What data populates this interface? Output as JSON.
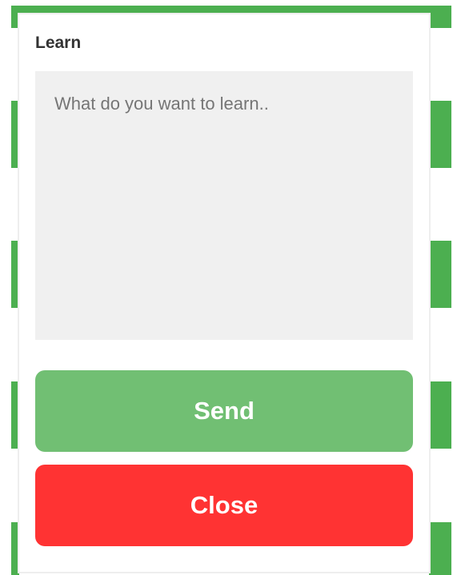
{
  "dialog": {
    "title": "Learn",
    "input": {
      "value": "",
      "placeholder": "What do you want to learn.."
    },
    "send_label": "Send",
    "close_label": "Close"
  },
  "colors": {
    "stripe_green": "#4caf50",
    "send_button": "#71bf73",
    "close_button": "#ff3333",
    "input_background": "#f0f0f0"
  }
}
